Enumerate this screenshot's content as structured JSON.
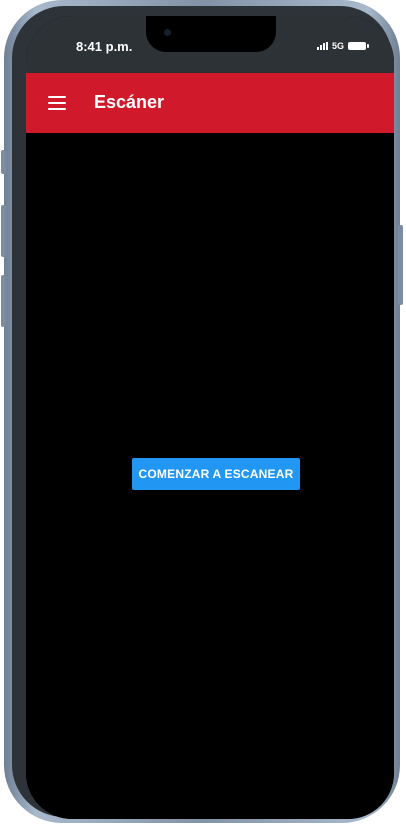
{
  "status_bar": {
    "time": "8:41 p.m.",
    "network": "5G"
  },
  "app_bar": {
    "title": "Escáner"
  },
  "icons": {
    "menu": "hamburger-menu-icon",
    "signal": "cellular-signal-icon",
    "battery": "battery-icon"
  },
  "main": {
    "scan_button_label": "COMENZAR A ESCANEAR"
  },
  "colors": {
    "app_bar": "#d0192a",
    "primary_button": "#2196f3",
    "screen_background": "#000000",
    "status_bar": "#2c3236"
  }
}
